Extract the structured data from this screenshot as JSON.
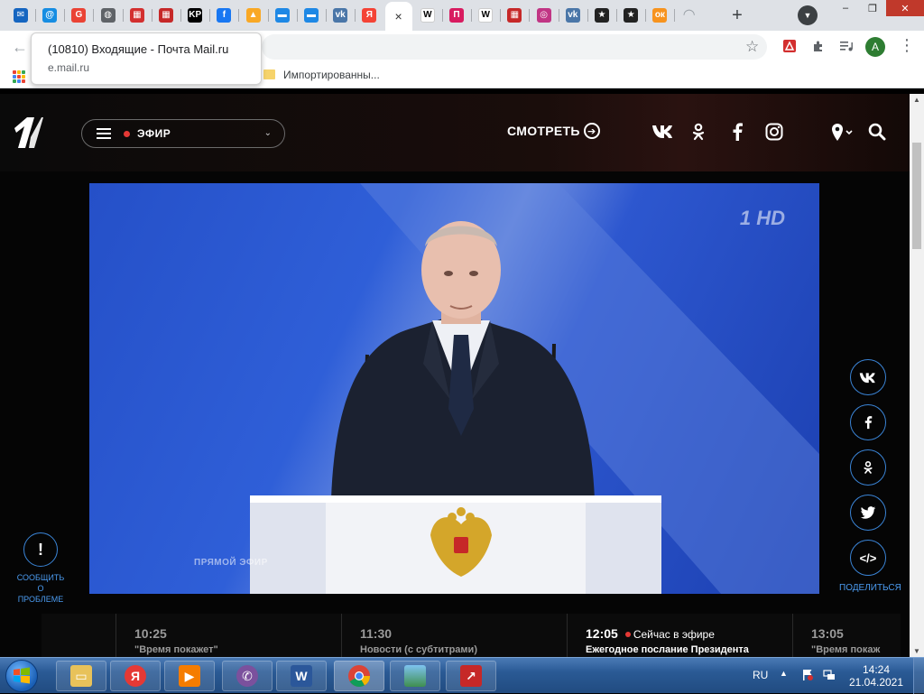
{
  "tabs": {
    "items": [
      {
        "icon": "mail-icon",
        "color": "#1565c0",
        "glyph": "✉"
      },
      {
        "icon": "mail-ru-icon",
        "color": "#168de2",
        "glyph": "@"
      },
      {
        "icon": "google-icon",
        "color": "#ea4335",
        "glyph": "G"
      },
      {
        "icon": "globe-icon",
        "color": "#5f6368",
        "glyph": "◍"
      },
      {
        "icon": "kp-red-icon",
        "color": "#d32f2f",
        "glyph": "▦"
      },
      {
        "icon": "kp-red-icon",
        "color": "#c62828",
        "glyph": "▦"
      },
      {
        "icon": "kp-icon",
        "color": "#000000",
        "glyph": "KP"
      },
      {
        "icon": "facebook-icon",
        "color": "#1877f2",
        "glyph": "f"
      },
      {
        "icon": "image-icon",
        "color": "#f9a825",
        "glyph": "▲"
      },
      {
        "icon": "chat-icon",
        "color": "#1e88e5",
        "glyph": "▬"
      },
      {
        "icon": "chat-icon",
        "color": "#1e88e5",
        "glyph": "▬"
      },
      {
        "icon": "vk-icon",
        "color": "#4a76a8",
        "glyph": "vk"
      },
      {
        "icon": "yandex-icon",
        "color": "#f44336",
        "glyph": "Я"
      },
      {
        "icon": "close-icon",
        "color": "",
        "glyph": "×"
      },
      {
        "icon": "wikipedia-icon",
        "color": "#ffffff",
        "glyph": "W"
      },
      {
        "icon": "p-icon",
        "color": "#d81b60",
        "glyph": "П"
      },
      {
        "icon": "wikipedia-icon",
        "color": "#ffffff",
        "glyph": "W"
      },
      {
        "icon": "kp-red-icon",
        "color": "#c62828",
        "glyph": "▦"
      },
      {
        "icon": "instagram-icon",
        "color": "#c13584",
        "glyph": "◎"
      },
      {
        "icon": "vk-icon",
        "color": "#4a76a8",
        "glyph": "vk"
      },
      {
        "icon": "star-icon",
        "color": "#222222",
        "glyph": "★"
      },
      {
        "icon": "star-icon",
        "color": "#222222",
        "glyph": "★"
      },
      {
        "icon": "odnoklassniki-icon",
        "color": "#f7931e",
        "glyph": "ок"
      },
      {
        "icon": "loading-icon",
        "color": "",
        "glyph": "◠"
      }
    ],
    "new_tab": "+"
  },
  "window_controls": {
    "minimize": "–",
    "restore": "❐",
    "close": "✕"
  },
  "toolbar": {
    "back": "←",
    "star": "☆",
    "avatar_letter": "A",
    "menu": "⋮"
  },
  "bookmarks": {
    "folder_label": "Импортированны..."
  },
  "tooltip": {
    "title": "(10810) Входящие - Почта Mail.ru",
    "url": "e.mail.ru"
  },
  "site": {
    "efir_label": "ЭФИР",
    "watch_label": "СМОТРЕТЬ",
    "report_label_line1": "СООБЩИТЬ О",
    "report_label_line2": "ПРОБЛЕМЕ",
    "share_label": "ПОДЕЛИТЬСЯ",
    "video_hd": "HD",
    "video_live_tag": "ПРЯМОЙ ЭФИР"
  },
  "schedule": [
    {
      "time": "10:25",
      "title": "\"Время покажет\"",
      "now": false
    },
    {
      "time": "11:30",
      "title": "Новости (с субтитрами)",
      "now": false
    },
    {
      "time": "12:05",
      "title": "Ежегодное послание Президента",
      "now": true,
      "now_label": "Сейчас в эфире"
    },
    {
      "time": "13:05",
      "title": "\"Время покаж",
      "now": false
    }
  ],
  "taskbar": {
    "lang": "RU",
    "time": "14:24",
    "date": "21.04.2021"
  },
  "colors": {
    "accent_blue": "#3a84d6",
    "live_red": "#e53935",
    "video_blue": "#2d57cf"
  }
}
